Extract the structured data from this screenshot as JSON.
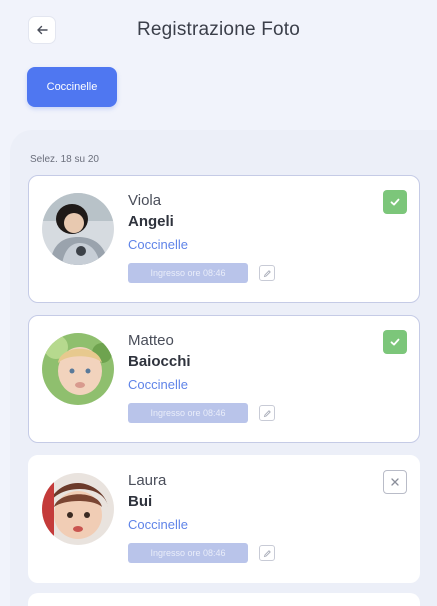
{
  "header": {
    "title": "Registrazione Foto",
    "back_icon": "arrow-left-icon"
  },
  "filter": {
    "group_label": "Coccinelle",
    "accent": "#4f77f1"
  },
  "selection": {
    "label": "Selez. 18 su 20"
  },
  "children": [
    {
      "first_name": "Viola",
      "last_name": "Angeli",
      "group": "Coccinelle",
      "entry": "Ingresso ore 08:46",
      "selected": true
    },
    {
      "first_name": "Matteo",
      "last_name": "Baiocchi",
      "group": "Coccinelle",
      "entry": "Ingresso ore 08:46",
      "selected": true
    },
    {
      "first_name": "Laura",
      "last_name": "Bui",
      "group": "Coccinelle",
      "entry": "Ingresso ore 08:46",
      "selected": false
    }
  ],
  "colors": {
    "check": "#7cc67a",
    "group_text": "#5f84e8",
    "badge": "#b9c4ea"
  }
}
